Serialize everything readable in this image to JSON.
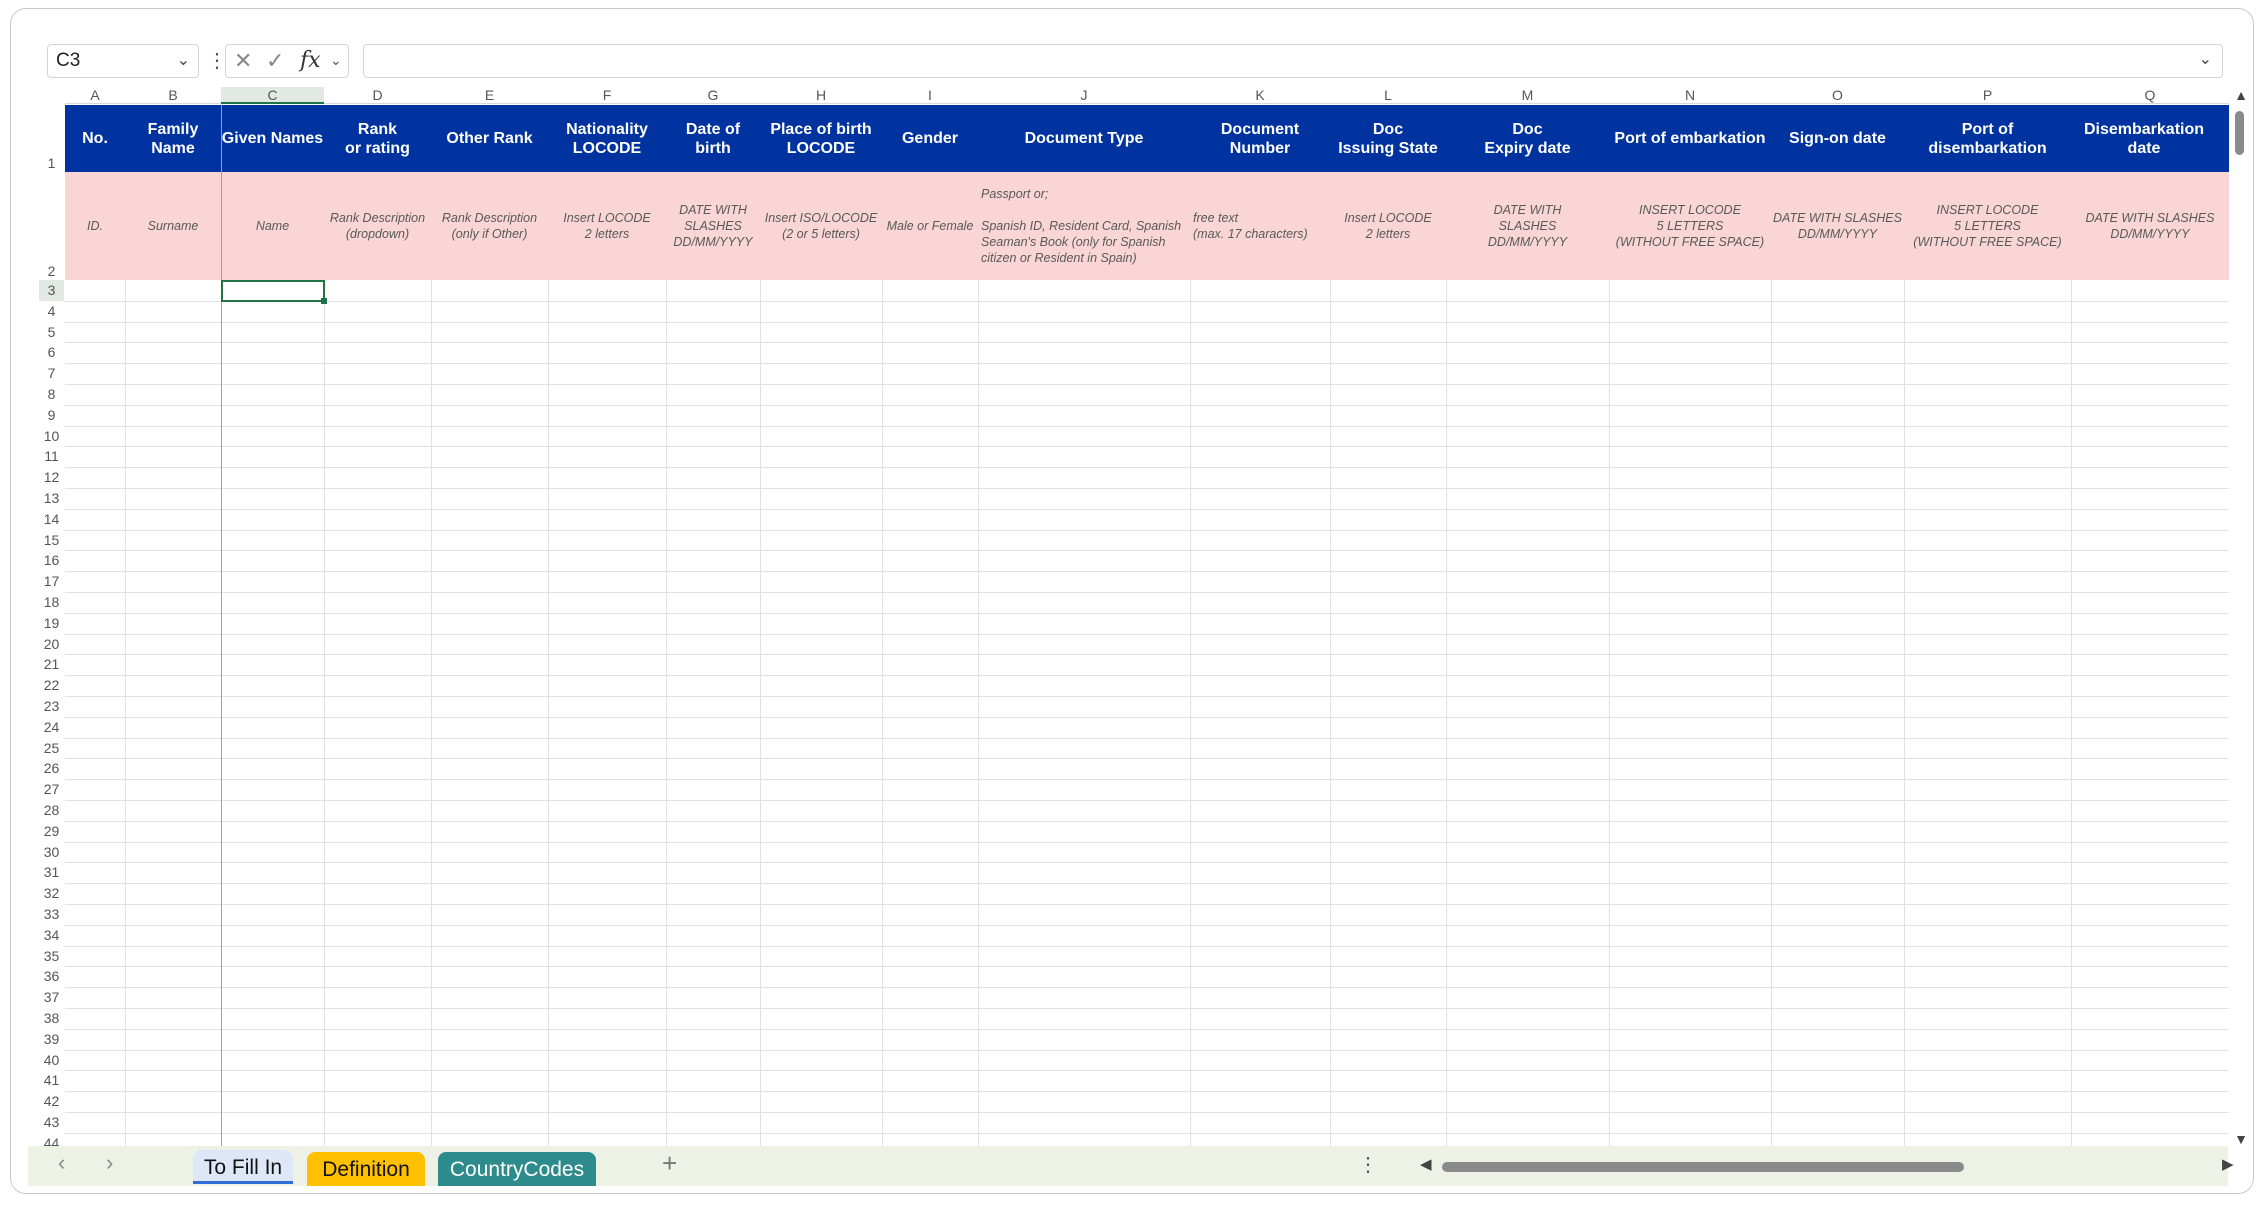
{
  "formula_bar": {
    "name_box": "C3",
    "cancel_icon": "close-icon",
    "enter_icon": "check-icon",
    "fx_label": "fx",
    "formula": ""
  },
  "columns": [
    {
      "letter": "A",
      "header": "No.",
      "hint": "ID."
    },
    {
      "letter": "B",
      "header": "Family Name",
      "hint": "Surname"
    },
    {
      "letter": "C",
      "header": "Given Names",
      "hint": "Name"
    },
    {
      "letter": "D",
      "header": "Rank\nor rating",
      "hint": "Rank Description\n(dropdown)"
    },
    {
      "letter": "E",
      "header": "Other Rank",
      "hint": "Rank Description\n(only if Other)"
    },
    {
      "letter": "F",
      "header": "Nationality\nLOCODE",
      "hint": "Insert LOCODE\n2 letters"
    },
    {
      "letter": "G",
      "header": "Date of birth",
      "hint": "DATE WITH\nSLASHES\nDD/MM/YYYY"
    },
    {
      "letter": "H",
      "header": "Place of birth\nLOCODE",
      "hint": "Insert ISO/LOCODE\n(2 or 5 letters)"
    },
    {
      "letter": "I",
      "header": "Gender",
      "hint": "Male or Female"
    },
    {
      "letter": "J",
      "header": "Document Type",
      "hint": "Passport or;\n\nSpanish ID, Resident Card, Spanish\nSeaman's Book (only for Spanish\ncitizen or Resident in Spain)"
    },
    {
      "letter": "K",
      "header": "Document\nNumber",
      "hint": "free text\n(max. 17 characters)"
    },
    {
      "letter": "L",
      "header": "Doc\nIssuing State",
      "hint": "Insert LOCODE\n2 letters"
    },
    {
      "letter": "M",
      "header": "Doc\nExpiry date",
      "hint": "DATE WITH\nSLASHES\nDD/MM/YYYY"
    },
    {
      "letter": "N",
      "header": "Port of embarkation",
      "hint": "INSERT LOCODE\n5 LETTERS\n(WITHOUT FREE SPACE)"
    },
    {
      "letter": "O",
      "header": "Sign-on date",
      "hint": "DATE WITH SLASHES\nDD/MM/YYYY"
    },
    {
      "letter": "P",
      "header": "Port of disembarkation",
      "hint": "INSERT LOCODE\n5 LETTERS\n(WITHOUT FREE SPACE)"
    },
    {
      "letter": "Q",
      "header": "Disembarkation date",
      "hint": "DATE WITH SLASHES\nDD/MM/YYYY"
    }
  ],
  "selected_cell": "C3",
  "first_row": 1,
  "last_row": 44,
  "sheet_tabs": [
    {
      "label": "To Fill In",
      "active": true
    },
    {
      "label": "Definition",
      "active": false
    },
    {
      "label": "CountryCodes",
      "active": false
    }
  ],
  "colors": {
    "header_bg": "#0033a0",
    "hint_bg": "#f9d5d5",
    "selection": "#217346",
    "tab_definition": "#ffc000",
    "tab_countrycodes": "#2e8b8b"
  }
}
